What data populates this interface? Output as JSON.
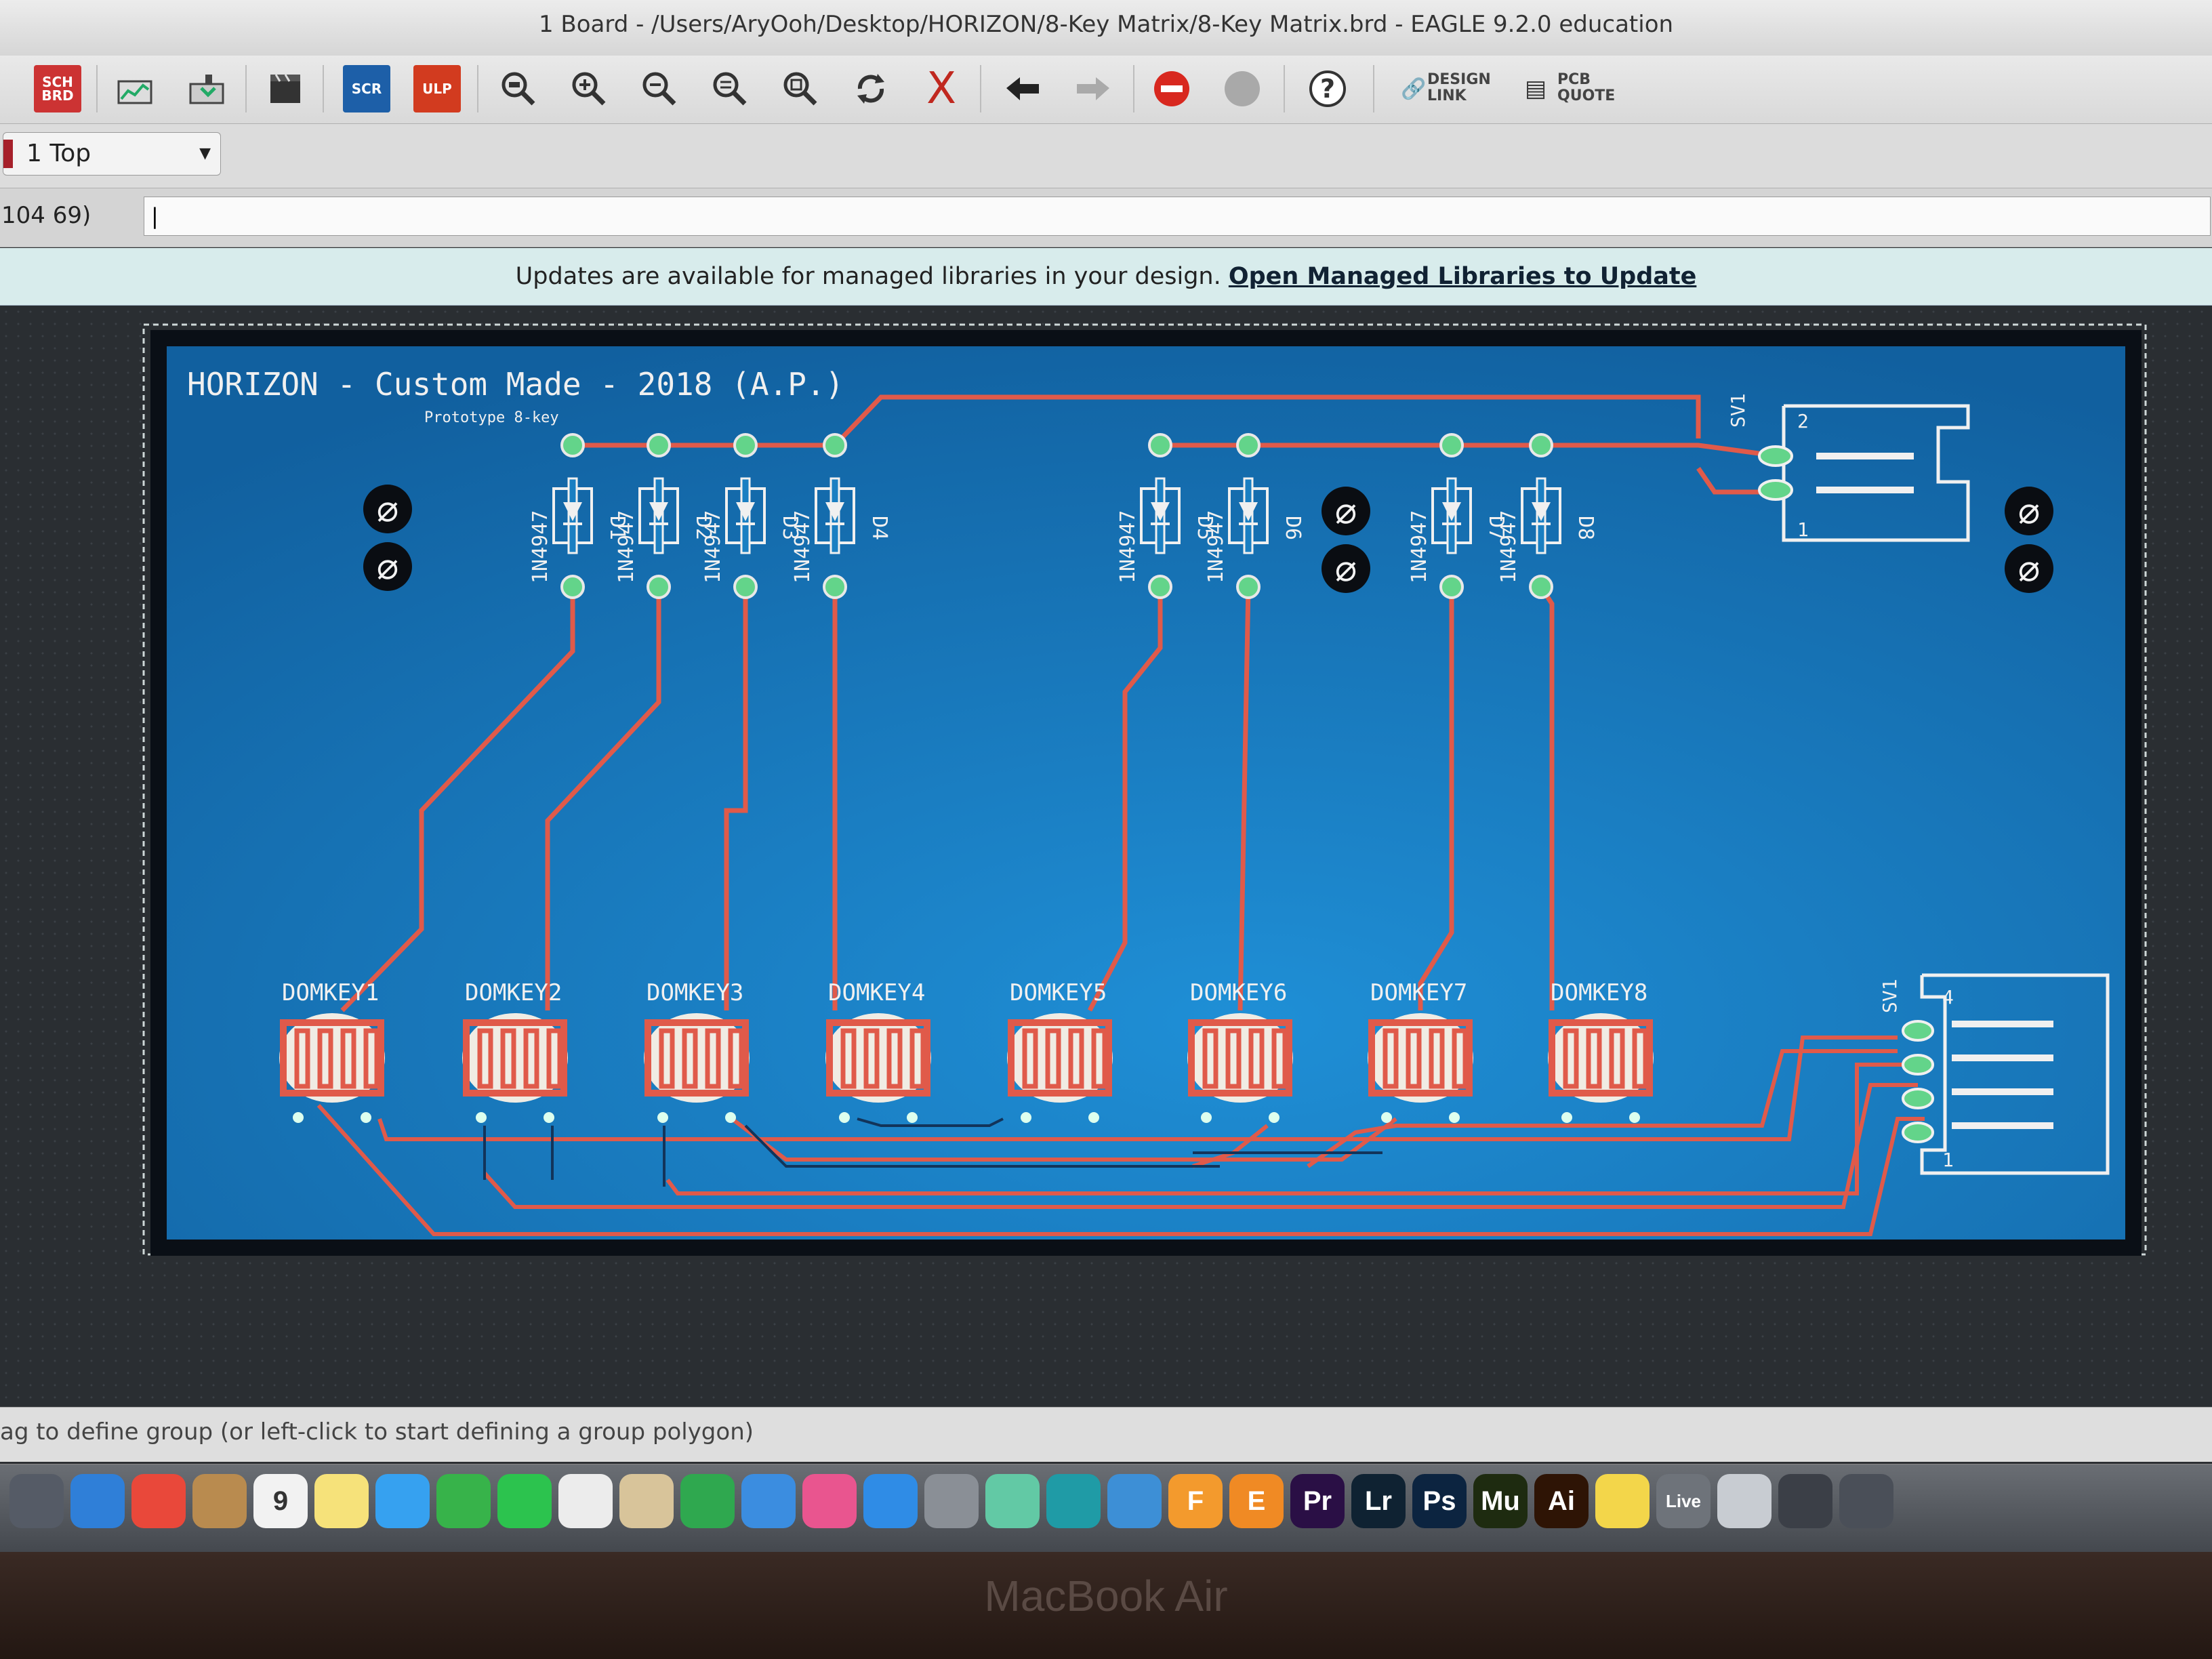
{
  "window": {
    "title": "1 Board - /Users/AryOoh/Desktop/HORIZON/8-Key Matrix/8-Key Matrix.brd - EAGLE 9.2.0 education"
  },
  "toolbar": {
    "sch_brd_label_top": "SCH",
    "sch_brd_label_bottom": "BRD",
    "scr_label": "SCR",
    "ulp_label": "ULP",
    "design_link_line1": "DESIGN",
    "design_link_line2": "LINK",
    "pcb_quote_line1": "PCB",
    "pcb_quote_line2": "QUOTE",
    "help_label": "?",
    "icons": [
      "switch-sch-brd-icon",
      "cam-processor-icon",
      "manufacturing-icon",
      "clapboard-icon",
      "script-icon",
      "ulp-icon",
      "zoom-fit-icon",
      "zoom-in-icon",
      "zoom-out-icon",
      "zoom-redraw-icon",
      "zoom-select-icon",
      "refresh-icon",
      "cancel-x-icon",
      "undo-icon",
      "redo-icon",
      "stop-icon",
      "go-icon",
      "help-icon",
      "design-link-icon",
      "pcb-quote-icon"
    ]
  },
  "layer_select": {
    "value": "1 Top",
    "color": "#a6202a"
  },
  "command": {
    "coordinates": "104 69)",
    "value": "|"
  },
  "notification": {
    "text": "Updates are available for managed libraries in your design.",
    "link": "Open Managed Libraries to Update"
  },
  "board": {
    "title": "HORIZON - Custom Made - 2018 (A.P.)",
    "subtitle": "Prototype 8-key",
    "fill_color": "#1a7fc2",
    "trace_color": "#e05a4a",
    "diodes": [
      {
        "ref": "D1",
        "value": "1N4947"
      },
      {
        "ref": "D2",
        "value": "1N4947"
      },
      {
        "ref": "D3",
        "value": "1N4947"
      },
      {
        "ref": "D4",
        "value": "1N4947"
      },
      {
        "ref": "D5",
        "value": "1N4947"
      },
      {
        "ref": "D6",
        "value": "1N4947"
      },
      {
        "ref": "D7",
        "value": "1N4947"
      },
      {
        "ref": "D8",
        "value": "1N4947"
      }
    ],
    "keys": [
      "DOMKEY1",
      "DOMKEY2",
      "DOMKEY3",
      "DOMKEY4",
      "DOMKEY5",
      "DOMKEY6",
      "DOMKEY7",
      "DOMKEY8"
    ],
    "connectors": [
      {
        "ref": "SV1",
        "pin_first": "1",
        "pin_last": "2"
      },
      {
        "ref": "SV1",
        "pin_first": "1",
        "pin_last": "4"
      }
    ],
    "mount_hole_symbol": "⌀"
  },
  "status": {
    "text": "ag to define group (or left-click to start defining a group polygon)"
  },
  "dock": {
    "items": [
      {
        "name": "launchpad-icon",
        "label": "",
        "color": "#555b66"
      },
      {
        "name": "safari-icon",
        "label": "",
        "color": "#2f7fd8"
      },
      {
        "name": "chrome-icon",
        "label": "",
        "color": "#e9483a"
      },
      {
        "name": "notefile-icon",
        "label": "",
        "color": "#b98b4f"
      },
      {
        "name": "calendar-icon",
        "label": "9",
        "color": "#f2f2f2"
      },
      {
        "name": "notes-icon",
        "label": "",
        "color": "#f6e27a"
      },
      {
        "name": "messages-icon",
        "label": "",
        "color": "#36a1f0"
      },
      {
        "name": "facetime-icon",
        "label": "",
        "color": "#37b34a"
      },
      {
        "name": "whatsapp-icon",
        "label": "",
        "color": "#2cc34e"
      },
      {
        "name": "photos-icon",
        "label": "",
        "color": "#ececec"
      },
      {
        "name": "preview-icon",
        "label": "",
        "color": "#d8c49a"
      },
      {
        "name": "numbers-icon",
        "label": "",
        "color": "#2fa84f"
      },
      {
        "name": "keynote-icon",
        "label": "",
        "color": "#3b8de0"
      },
      {
        "name": "itunes-icon",
        "label": "",
        "color": "#e9558f"
      },
      {
        "name": "app-store-icon",
        "label": "",
        "color": "#2f8ce6"
      },
      {
        "name": "system-preferences-icon",
        "label": "",
        "color": "#8a8f96"
      },
      {
        "name": "atom-icon",
        "label": "",
        "color": "#62c9a5"
      },
      {
        "name": "arduino-icon",
        "label": "",
        "color": "#1f9ba6"
      },
      {
        "name": "xcode-icon",
        "label": "",
        "color": "#3d8fd6"
      },
      {
        "name": "fusion-icon",
        "label": "F",
        "color": "#f39a2d"
      },
      {
        "name": "eagle-icon",
        "label": "E",
        "color": "#f08a24"
      },
      {
        "name": "premiere-icon",
        "label": "Pr",
        "color": "#2a0f45"
      },
      {
        "name": "lightroom-icon",
        "label": "Lr",
        "color": "#0f2232"
      },
      {
        "name": "photoshop-icon",
        "label": "Ps",
        "color": "#0c2440"
      },
      {
        "name": "muse-icon",
        "label": "Mu",
        "color": "#1e2b10"
      },
      {
        "name": "illustrator-icon",
        "label": "Ai",
        "color": "#2e1405"
      },
      {
        "name": "stickies-icon",
        "label": "",
        "color": "#f3d64a"
      },
      {
        "name": "live-icon",
        "label": "Live",
        "color": "#6e737a"
      },
      {
        "name": "disk-utility-icon",
        "label": "",
        "color": "#c8ccd2"
      },
      {
        "name": "pro-tools-icon",
        "label": "",
        "color": "#3b3f47"
      },
      {
        "name": "stacks-icon",
        "label": "",
        "color": "#4a4f58"
      }
    ]
  },
  "laptop": {
    "model": "MacBook Air"
  }
}
